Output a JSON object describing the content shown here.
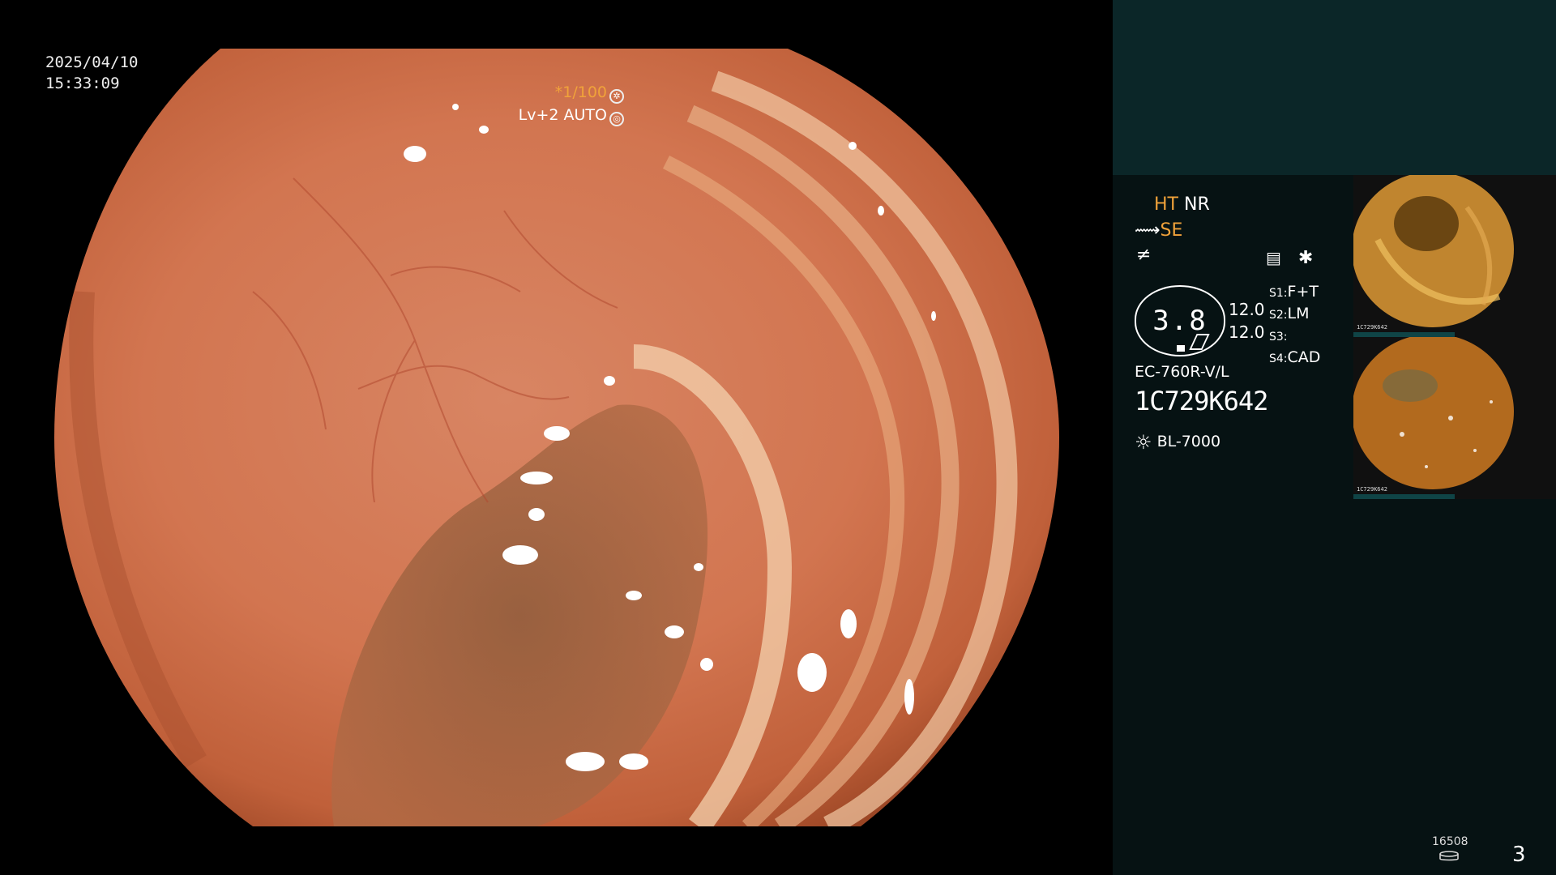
{
  "overlay": {
    "date": "2025/04/10",
    "time": "15:33:09",
    "shutter": "*1/100",
    "level": "Lv+2",
    "mode": "AUTO"
  },
  "panel": {
    "ht": "HT",
    "nr": "NR",
    "se": "SE",
    "gauge_value": "3.8",
    "values": [
      "12.0",
      "12.0"
    ],
    "switches": [
      {
        "key": "S1:",
        "value": "F+T"
      },
      {
        "key": "S2:",
        "value": "LM"
      },
      {
        "key": "S3:",
        "value": ""
      },
      {
        "key": "S4:",
        "value": "CAD"
      }
    ],
    "scope_model": "EC-760R-V/L",
    "serial": "1C729K642",
    "light_source": "BL-7000"
  },
  "thumbnails": [
    {
      "caption": "1C729K642"
    },
    {
      "caption": "1C729K642"
    }
  ],
  "footer": {
    "count": "16508",
    "page": "3"
  },
  "colors": {
    "accent_orange": "#f0a23a",
    "panel_bg": "#061213",
    "panel_top": "#0b2628"
  }
}
